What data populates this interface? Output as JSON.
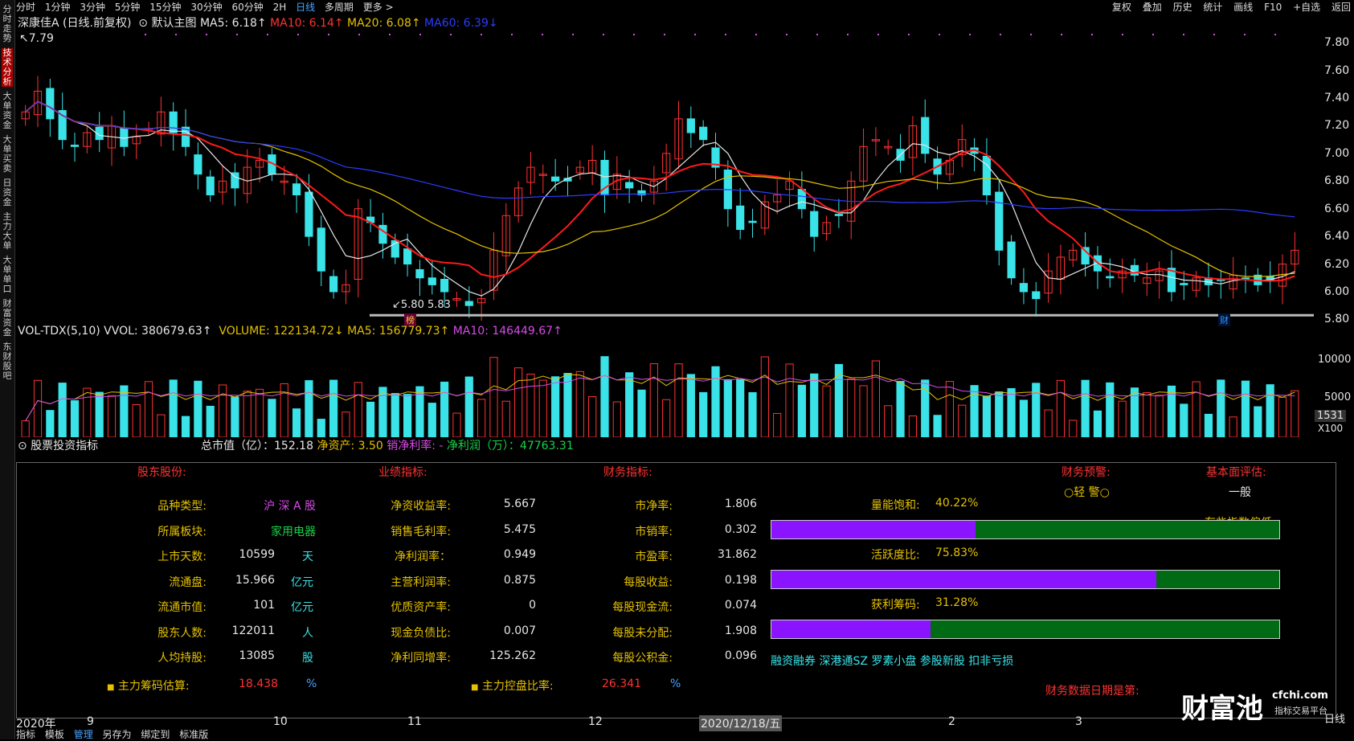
{
  "topbar": {
    "timeframes": [
      "分时",
      "1分钟",
      "3分钟",
      "5分钟",
      "15分钟",
      "30分钟",
      "60分钟",
      "2H",
      "日线",
      "多周期",
      "更多 >"
    ],
    "active": "日线",
    "right_tools": [
      "复权",
      "叠加",
      "历史",
      "统计",
      "画线",
      "F10",
      "+自选",
      "返回"
    ]
  },
  "left_tabs": [
    "分时走势",
    "技术分析",
    "大单资金",
    "大单买卖",
    "日资金",
    "主力大单",
    "大单单口",
    "财富资金",
    "东财股吧"
  ],
  "header": {
    "stock": "深康佳A (日线.前复权)",
    "chart_mode": "默认主图",
    "ma5": "MA5: 6.18↑",
    "ma10": "MA10: 6.14↑",
    "ma20": "MA20: 6.08↑",
    "ma60": "MA60: 6.39↓"
  },
  "price_axis": [
    "7.80",
    "7.60",
    "7.40",
    "7.20",
    "7.00",
    "6.80",
    "6.60",
    "6.40",
    "6.20",
    "6.00",
    "5.80"
  ],
  "high_mark": "7.79",
  "low_mark": "5.80",
  "low_line_label": "5.83",
  "chart_tags": {
    "bang": "榜",
    "cai": "财"
  },
  "volume_header": {
    "indicator": "VOL-TDX(5,10)",
    "vvol": "VVOL: 380679.63↑",
    "volume": "VOLUME: 122134.72↓",
    "ma5": "MA5: 156779.73↑",
    "ma10": "MA10: 146449.67↑"
  },
  "volume_axis": [
    "10000",
    "5000"
  ],
  "volume_unit": "X100",
  "volume_current": "1531",
  "fund_header": {
    "title": "股票投资指标",
    "market_cap": "总市值（亿）：152.18",
    "net_assets": "净资产: 3.50",
    "net_margin": "销净利率: -",
    "net_profit": "净利润（万）：47763.31"
  },
  "fundamentals": {
    "col1_title": "股东股份:",
    "col1": [
      {
        "k": "品种类型:",
        "v": "沪 深 A 股",
        "u": ""
      },
      {
        "k": "所属板块:",
        "v": "家用电器",
        "u": ""
      },
      {
        "k": "上市天数:",
        "v": "10599",
        "u": "天"
      },
      {
        "k": "流通盘:",
        "v": "15.966",
        "u": "亿元"
      },
      {
        "k": "流通市值:",
        "v": "101",
        "u": "亿元"
      },
      {
        "k": "股东人数:",
        "v": "122011",
        "u": "人"
      },
      {
        "k": "人均持股:",
        "v": "13085",
        "u": "股"
      }
    ],
    "col2_title": "业绩指标:",
    "col2": [
      {
        "k": "净资收益率:",
        "v": "5.667"
      },
      {
        "k": "销售毛利率:",
        "v": "5.475"
      },
      {
        "k": "净利润率：",
        "v": "0.949"
      },
      {
        "k": "主营利润率:",
        "v": "0.875"
      },
      {
        "k": "优质资产率:",
        "v": "0"
      },
      {
        "k": "现金负债比:",
        "v": "0.007"
      },
      {
        "k": "净利同增率:",
        "v": "125.262"
      }
    ],
    "col3_title": "财务指标:",
    "col3": [
      {
        "k": "市净率:",
        "v": "1.806"
      },
      {
        "k": "市销率:",
        "v": "0.302"
      },
      {
        "k": "市盈率:",
        "v": "31.862"
      },
      {
        "k": "每股收益:",
        "v": "0.198"
      },
      {
        "k": "每股现金流:",
        "v": "0.074"
      },
      {
        "k": "每股未分配:",
        "v": "1.908"
      },
      {
        "k": "每股公积金:",
        "v": "0.096"
      }
    ],
    "warn_title": "财务预警:",
    "warn_value": "○轻 警○",
    "eval_title": "基本面评估:",
    "eval_value": "一般",
    "eval_note": "有些指数偏低",
    "bars": [
      {
        "label": "量能饱和:",
        "value": "40.22%",
        "pct": 0.4022
      },
      {
        "label": "活跃度比:",
        "value": "75.83%",
        "pct": 0.7583
      },
      {
        "label": "获利筹码:",
        "value": "31.28%",
        "pct": 0.3128
      }
    ],
    "tags": "融资融券 深港通SZ 罗素小盘 参股新股 扣非亏损",
    "chip_label": "主力筹码估算:",
    "chip_value": "18.438",
    "chip_unit": "%",
    "control_label": "主力控盘比率:",
    "control_value": "26.341",
    "control_unit": "%",
    "report_date": "财务数据日期是第:"
  },
  "x_axis": [
    "2020年",
    "9",
    "10",
    "11",
    "12",
    "2020/12/18/五",
    "1",
    "2",
    "3"
  ],
  "footer_tabs": [
    "指标",
    "模板",
    "管理",
    "另存为",
    "绑定到",
    "标准版"
  ],
  "watermark": {
    "brand": "财富池",
    "domain": "cfchi.com",
    "sub": "指标交易平台"
  },
  "corner": "日线",
  "colors": {
    "up": "#ff3232",
    "down": "#39e3e8",
    "ma5": "#e6e6e6",
    "ma10": "#ff1a1a",
    "ma20": "#e5c100",
    "ma60": "#2a3cff",
    "vma5": "#e5c100",
    "vma10": "#d84be8",
    "bar_fill": "#8a14ff",
    "bar_bg": "#006a14"
  },
  "chart_data": {
    "type": "candlestick",
    "closes": [
      7.3,
      7.45,
      7.25,
      7.1,
      7.05,
      7.15,
      7.1,
      7.2,
      7.05,
      7.12,
      7.18,
      7.3,
      7.15,
      7.05,
      6.85,
      6.7,
      6.8,
      6.75,
      6.9,
      6.95,
      6.85,
      6.8,
      6.7,
      6.4,
      6.15,
      6.0,
      6.05,
      6.6,
      6.5,
      6.35,
      6.25,
      6.2,
      6.1,
      6.05,
      6.0,
      5.95,
      5.9,
      5.95,
      6.3,
      6.55,
      6.75,
      6.9,
      6.85,
      6.8,
      6.8,
      6.9,
      6.95,
      6.7,
      6.85,
      6.75,
      6.7,
      6.8,
      7.0,
      7.25,
      7.15,
      7.1,
      6.9,
      6.6,
      6.45,
      6.5,
      6.65,
      6.7,
      6.8,
      6.6,
      6.4,
      6.5,
      6.55,
      6.8,
      7.05,
      7.1,
      7.05,
      6.95,
      7.2,
      7.0,
      6.85,
      6.95,
      7.1,
      7.0,
      6.7,
      6.3,
      6.1,
      6.0,
      5.95,
      6.15,
      6.25,
      6.3,
      6.2,
      6.15,
      6.1,
      6.15,
      6.12,
      6.1,
      6.15,
      6.0,
      6.05,
      6.1,
      6.05,
      6.08,
      6.12,
      6.1,
      6.05,
      6.08,
      6.2,
      6.3
    ],
    "ylim": [
      5.75,
      7.9
    ]
  }
}
